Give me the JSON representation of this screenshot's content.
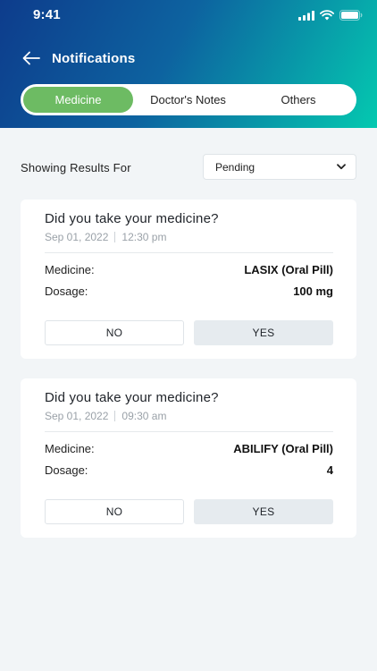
{
  "status_bar": {
    "time": "9:41",
    "icons": [
      "cellular-signal-icon",
      "wifi-icon",
      "battery-icon"
    ]
  },
  "header": {
    "back_icon": "arrow-left-icon",
    "title": "Notifications"
  },
  "tabs": [
    {
      "label": "Medicine",
      "active": true
    },
    {
      "label": "Doctor's Notes",
      "active": false
    },
    {
      "label": "Others",
      "active": false
    }
  ],
  "filter": {
    "label": "Showing Results For",
    "selected": "Pending",
    "icon": "chevron-down-icon"
  },
  "cards": [
    {
      "title": "Did you take your medicine?",
      "date": "Sep 01, 2022",
      "time": "12:30 pm",
      "medicine_label": "Medicine:",
      "medicine_value": "LASIX (Oral Pill)",
      "dosage_label": "Dosage:",
      "dosage_value": "100 mg",
      "no_label": "NO",
      "yes_label": "YES"
    },
    {
      "title": "Did you take your medicine?",
      "date": "Sep 01, 2022",
      "time": "09:30 am",
      "medicine_label": "Medicine:",
      "medicine_value": "ABILIFY (Oral Pill)",
      "dosage_label": "Dosage:",
      "dosage_value": "4",
      "no_label": "NO",
      "yes_label": "YES"
    }
  ],
  "colors": {
    "header_gradient_start": "#0d3c8c",
    "header_gradient_end": "#04c9b0",
    "active_tab": "#6dbb63",
    "page_background": "#f2f5f7"
  }
}
